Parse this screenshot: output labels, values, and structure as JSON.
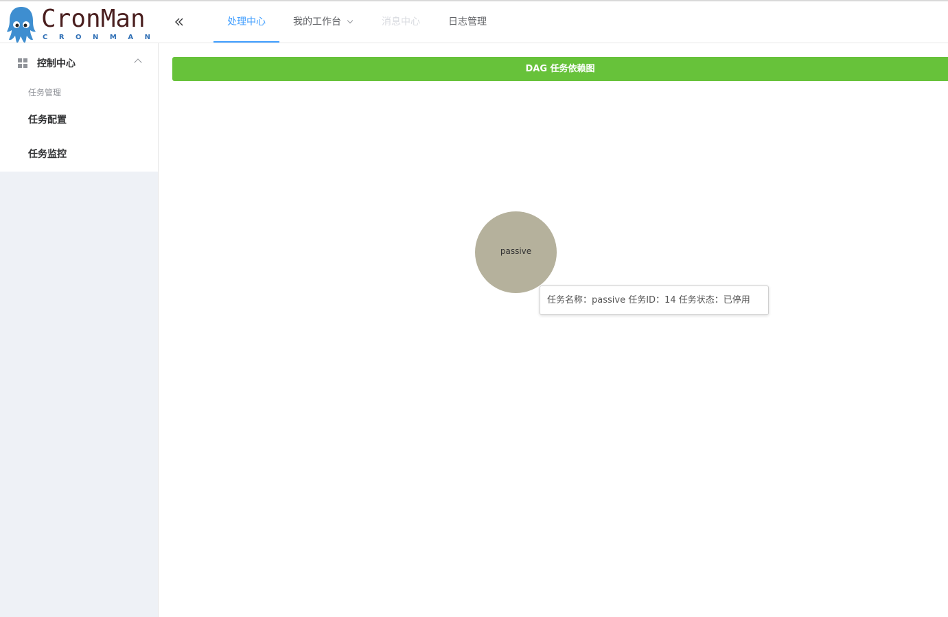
{
  "brand": {
    "title": "CronMan",
    "subtitle": "CRONMAN",
    "mascot_color": "#3e8ed0"
  },
  "sidebar": {
    "menu_label": "控制中心",
    "group_title": "任务管理",
    "items": [
      {
        "label": "任务配置"
      },
      {
        "label": "任务监控"
      }
    ]
  },
  "header": {
    "tabs": [
      {
        "label": "处理中心",
        "state": "active"
      },
      {
        "label": "我的工作台",
        "state": "dropdown"
      },
      {
        "label": "消息中心",
        "state": "disabled"
      },
      {
        "label": "日志管理",
        "state": "normal"
      }
    ],
    "active_color": "#409eff"
  },
  "content": {
    "banner_label": "DAG 任务依赖图",
    "banner_color": "#67c23a",
    "node": {
      "label": "passive",
      "color": "#b5b19c"
    },
    "tooltip": "任务名称：passive 任务ID：14 任务状态：已停用"
  }
}
